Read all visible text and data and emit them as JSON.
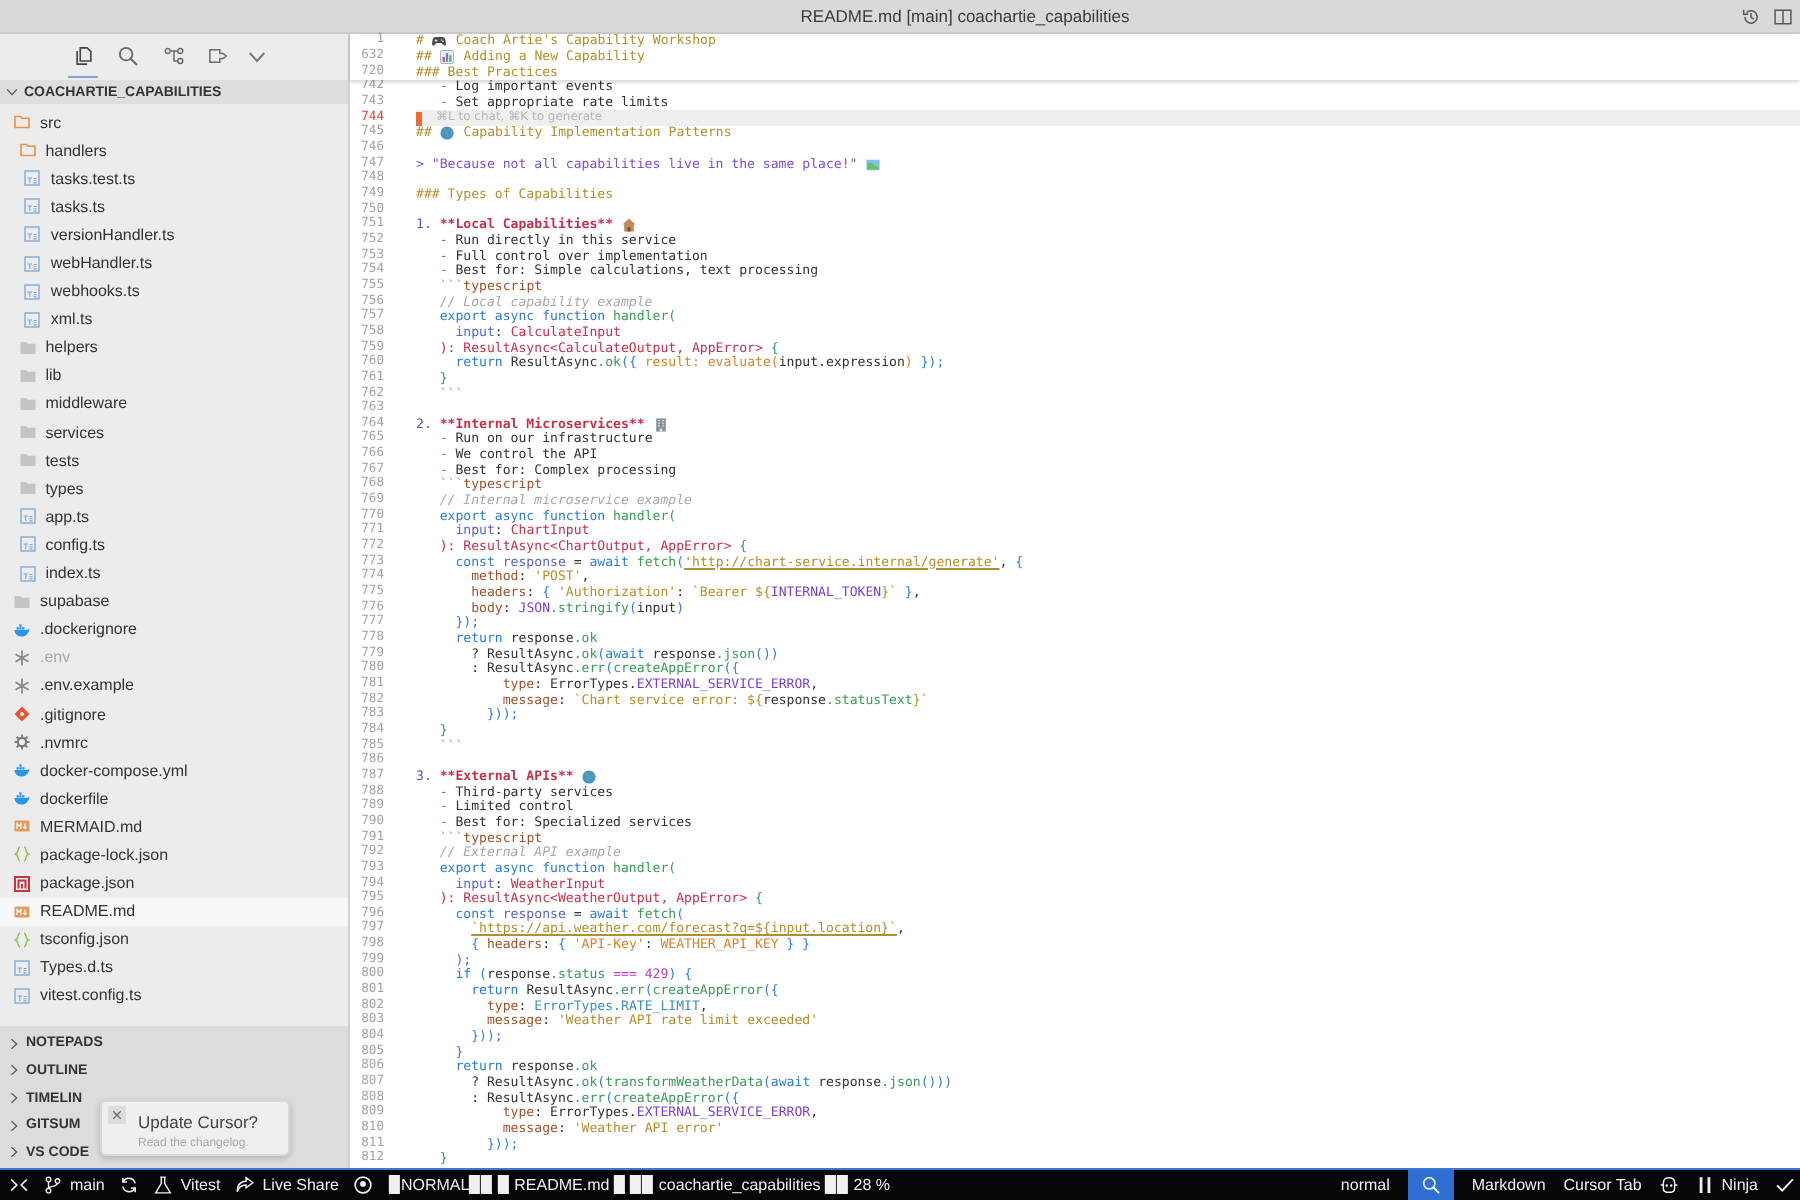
{
  "window": {
    "title": "README.md [main] coachartie_capabilities"
  },
  "activity_bar": [
    {
      "kind": "files",
      "selected": true
    },
    {
      "kind": "search",
      "selected": false
    },
    {
      "kind": "graph",
      "selected": false
    },
    {
      "kind": "extensions",
      "selected": false
    }
  ],
  "explorer": {
    "title": "COACHARTIE_CAPABILITIES",
    "expanded": true,
    "tree": [
      {
        "name": "src",
        "kind": "folder",
        "expanded": true,
        "selected": false,
        "ignored": false,
        "children": [
          {
            "name": "handlers",
            "kind": "folder",
            "expanded": true,
            "selected": false,
            "ignored": false,
            "children": [
              {
                "name": "tasks.test.ts",
                "kind": "ts",
                "selected": false,
                "ignored": false
              },
              {
                "name": "tasks.ts",
                "kind": "ts",
                "selected": false,
                "ignored": false
              },
              {
                "name": "versionHandler.ts",
                "kind": "ts",
                "selected": false,
                "ignored": false
              },
              {
                "name": "webHandler.ts",
                "kind": "ts",
                "selected": false,
                "ignored": false
              },
              {
                "name": "webhooks.ts",
                "kind": "ts",
                "selected": false,
                "ignored": false
              },
              {
                "name": "xml.ts",
                "kind": "ts",
                "selected": false,
                "ignored": false
              }
            ]
          },
          {
            "name": "helpers",
            "kind": "folder",
            "expanded": false,
            "selected": false,
            "ignored": false
          },
          {
            "name": "lib",
            "kind": "folder",
            "expanded": false,
            "selected": false,
            "ignored": false
          },
          {
            "name": "middleware",
            "kind": "folder",
            "expanded": false,
            "selected": false,
            "ignored": false
          },
          {
            "name": "services",
            "kind": "folder",
            "expanded": false,
            "selected": false,
            "ignored": false
          },
          {
            "name": "tests",
            "kind": "folder",
            "expanded": false,
            "selected": false,
            "ignored": false
          },
          {
            "name": "types",
            "kind": "folder",
            "expanded": false,
            "selected": false,
            "ignored": false
          },
          {
            "name": "app.ts",
            "kind": "ts",
            "selected": false,
            "ignored": false
          },
          {
            "name": "config.ts",
            "kind": "ts",
            "selected": false,
            "ignored": false
          },
          {
            "name": "index.ts",
            "kind": "ts",
            "selected": false,
            "ignored": false
          }
        ]
      },
      {
        "name": "supabase",
        "kind": "folder",
        "expanded": false,
        "selected": false,
        "ignored": false
      },
      {
        "name": ".dockerignore",
        "kind": "docker",
        "selected": false,
        "ignored": false
      },
      {
        "name": ".env",
        "kind": "env",
        "selected": false,
        "ignored": true
      },
      {
        "name": ".env.example",
        "kind": "env",
        "selected": false,
        "ignored": false
      },
      {
        "name": ".gitignore",
        "kind": "git",
        "selected": false,
        "ignored": false
      },
      {
        "name": ".nvmrc",
        "kind": "gear",
        "selected": false,
        "ignored": false
      },
      {
        "name": "docker-compose.yml",
        "kind": "docker",
        "selected": false,
        "ignored": false
      },
      {
        "name": "dockerfile",
        "kind": "docker",
        "selected": false,
        "ignored": false
      },
      {
        "name": "MERMAID.md",
        "kind": "markdown",
        "selected": false,
        "ignored": false
      },
      {
        "name": "package-lock.json",
        "kind": "json",
        "selected": false,
        "ignored": false
      },
      {
        "name": "package.json",
        "kind": "npm",
        "selected": false,
        "ignored": false
      },
      {
        "name": "README.md",
        "kind": "markdown",
        "selected": true,
        "ignored": false
      },
      {
        "name": "tsconfig.json",
        "kind": "json",
        "selected": false,
        "ignored": false
      },
      {
        "name": "Types.d.ts",
        "kind": "ts",
        "selected": false,
        "ignored": false
      },
      {
        "name": "vitest.config.ts",
        "kind": "ts",
        "selected": false,
        "ignored": false
      }
    ]
  },
  "panels": [
    {
      "label": "NOTEPADS",
      "expanded": false
    },
    {
      "label": "OUTLINE",
      "expanded": false
    },
    {
      "label": "TIMELIN",
      "expanded": false
    },
    {
      "label": "GITSUM",
      "expanded": false
    },
    {
      "label": "VS CODE",
      "expanded": false
    }
  ],
  "notification": {
    "title": "Update Cursor?",
    "message": "Read the changelog."
  },
  "editor": {
    "sticky_lines": [
      {
        "number": "1",
        "tokens": [
          {
            "kind": "heading",
            "text": "# "
          },
          {
            "kind": "gamepad"
          },
          {
            "kind": "heading",
            "text": " Coach Artie's Capability Workshop"
          }
        ]
      },
      {
        "number": "632",
        "tokens": [
          {
            "kind": "heading",
            "text": "## "
          },
          {
            "kind": "chart"
          },
          {
            "kind": "heading",
            "text": " Adding a New Capability"
          }
        ]
      },
      {
        "number": "720",
        "tokens": [
          {
            "kind": "heading",
            "text": "### Best Practices"
          }
        ]
      }
    ],
    "lines": [
      {
        "number": "742",
        "current": false,
        "tokens": [
          {
            "kind": "dash",
            "text": "   - "
          },
          {
            "kind": "plain",
            "text": "Log important events"
          }
        ]
      },
      {
        "number": "743",
        "current": false,
        "tokens": [
          {
            "kind": "dash",
            "text": "   - "
          },
          {
            "kind": "plain",
            "text": "Set appropriate rate limits"
          }
        ]
      },
      {
        "number": "744",
        "current": true,
        "hint": "⌘L to chat, ⌘K to generate"
      },
      {
        "number": "745",
        "current": false,
        "tokens": [
          {
            "kind": "heading",
            "text": "## "
          },
          {
            "kind": "globe"
          },
          {
            "kind": "heading",
            "text": " Capability Implementation Patterns"
          }
        ]
      },
      {
        "number": "746",
        "current": false
      },
      {
        "number": "747",
        "current": false,
        "tokens": [
          {
            "kind": "quote",
            "text": "> \"Because not all capabilities live in the same place!\" "
          },
          {
            "kind": "map"
          }
        ]
      },
      {
        "number": "748",
        "current": false
      },
      {
        "number": "749",
        "current": false,
        "tokens": [
          {
            "kind": "heading",
            "text": "### Types of Capabilities"
          }
        ]
      },
      {
        "number": "750",
        "current": false
      },
      {
        "number": "751",
        "current": false,
        "tokens": [
          {
            "kind": "listnum",
            "text": "1. "
          },
          {
            "kind": "bold",
            "text": "**Local Capabilities** "
          },
          {
            "kind": "house"
          }
        ]
      },
      {
        "number": "752",
        "current": false,
        "tokens": [
          {
            "kind": "dash",
            "text": "   - "
          },
          {
            "kind": "plain",
            "text": "Run directly in this service"
          }
        ]
      },
      {
        "number": "753",
        "current": false,
        "tokens": [
          {
            "kind": "dash",
            "text": "   - "
          },
          {
            "kind": "plain",
            "text": "Full control over implementation"
          }
        ]
      },
      {
        "number": "754",
        "current": false,
        "tokens": [
          {
            "kind": "dash",
            "text": "   - "
          },
          {
            "kind": "plain",
            "text": "Best for: Simple calculations, text processing"
          }
        ]
      },
      {
        "number": "755",
        "current": false,
        "tokens": [
          {
            "kind": "fence",
            "text": "   ```"
          },
          {
            "kind": "lang",
            "text": "typescript"
          }
        ]
      },
      {
        "number": "756",
        "current": false,
        "tokens": [
          {
            "kind": "comment",
            "text": "   // Local capability example"
          }
        ]
      },
      {
        "number": "757",
        "current": false,
        "tokens": [
          {
            "kind": "keyword",
            "text": "   export async function "
          },
          {
            "kind": "func",
            "text": "handler("
          }
        ]
      },
      {
        "number": "758",
        "current": false,
        "tokens": [
          {
            "kind": "param",
            "text": "     input"
          },
          {
            "kind": "plain",
            "text": ": "
          },
          {
            "kind": "type",
            "text": "CalculateInput"
          }
        ]
      },
      {
        "number": "759",
        "current": false,
        "tokens": [
          {
            "kind": "type",
            "text": "   ): ResultAsync<CalculateOutput, AppError> "
          },
          {
            "kind": "func",
            "text": "{"
          }
        ]
      },
      {
        "number": "760",
        "current": false,
        "tokens": [
          {
            "kind": "keyword",
            "text": "     return "
          },
          {
            "kind": "plain",
            "text": "ResultAsync"
          },
          {
            "kind": "func",
            "text": ".ok"
          },
          {
            "kind": "brace",
            "text": "({ "
          },
          {
            "kind": "prop",
            "text": "result: evaluate("
          },
          {
            "kind": "plain",
            "text": "input.expression"
          },
          {
            "kind": "prop",
            "text": ") "
          },
          {
            "kind": "brace",
            "text": "});"
          }
        ]
      },
      {
        "number": "761",
        "current": false,
        "tokens": [
          {
            "kind": "func",
            "text": "   }"
          }
        ]
      },
      {
        "number": "762",
        "current": false,
        "tokens": [
          {
            "kind": "fence",
            "text": "   ```"
          }
        ]
      },
      {
        "number": "763",
        "current": false
      },
      {
        "number": "764",
        "current": false,
        "tokens": [
          {
            "kind": "listnum",
            "text": "2. "
          },
          {
            "kind": "bold",
            "text": "**Internal Microservices** "
          },
          {
            "kind": "building"
          }
        ]
      },
      {
        "number": "765",
        "current": false,
        "tokens": [
          {
            "kind": "dash",
            "text": "   - "
          },
          {
            "kind": "plain",
            "text": "Run on our infrastructure"
          }
        ]
      },
      {
        "number": "766",
        "current": false,
        "tokens": [
          {
            "kind": "dash",
            "text": "   - "
          },
          {
            "kind": "plain",
            "text": "We control the API"
          }
        ]
      },
      {
        "number": "767",
        "current": false,
        "tokens": [
          {
            "kind": "dash",
            "text": "   - "
          },
          {
            "kind": "plain",
            "text": "Best for: Complex processing"
          }
        ]
      },
      {
        "number": "768",
        "current": false,
        "tokens": [
          {
            "kind": "fence",
            "text": "   ```"
          },
          {
            "kind": "lang",
            "text": "typescript"
          }
        ]
      },
      {
        "number": "769",
        "current": false,
        "tokens": [
          {
            "kind": "comment",
            "text": "   // Internal microservice example"
          }
        ]
      },
      {
        "number": "770",
        "current": false,
        "tokens": [
          {
            "kind": "keyword",
            "text": "   export async function "
          },
          {
            "kind": "func",
            "text": "handler("
          }
        ]
      },
      {
        "number": "771",
        "current": false,
        "tokens": [
          {
            "kind": "param",
            "text": "     input"
          },
          {
            "kind": "plain",
            "text": ": "
          },
          {
            "kind": "type",
            "text": "ChartInput"
          }
        ]
      },
      {
        "number": "772",
        "current": false,
        "tokens": [
          {
            "kind": "type",
            "text": "   ): ResultAsync<ChartOutput, AppError> "
          },
          {
            "kind": "func",
            "text": "{"
          }
        ]
      },
      {
        "number": "773",
        "current": false,
        "tokens": [
          {
            "kind": "keyword",
            "text": "     const "
          },
          {
            "kind": "param",
            "text": "response"
          },
          {
            "kind": "plain",
            "text": " = "
          },
          {
            "kind": "keyword",
            "text": "await "
          },
          {
            "kind": "func",
            "text": "fetch"
          },
          {
            "kind": "brace",
            "text": "("
          },
          {
            "kind": "link",
            "text": "'http://chart-service.internal/generate'"
          },
          {
            "kind": "plain",
            "text": ", "
          },
          {
            "kind": "brace",
            "text": "{"
          }
        ]
      },
      {
        "number": "774",
        "current": false,
        "tokens": [
          {
            "kind": "field",
            "text": "       method"
          },
          {
            "kind": "plain",
            "text": ": "
          },
          {
            "kind": "string",
            "text": "'POST'"
          },
          {
            "kind": "plain",
            "text": ","
          }
        ]
      },
      {
        "number": "775",
        "current": false,
        "tokens": [
          {
            "kind": "field",
            "text": "       headers"
          },
          {
            "kind": "plain",
            "text": ": "
          },
          {
            "kind": "brace",
            "text": "{ "
          },
          {
            "kind": "string",
            "text": "'Authorization'"
          },
          {
            "kind": "plain",
            "text": ": "
          },
          {
            "kind": "string",
            "text": "`Bearer ${"
          },
          {
            "kind": "constant",
            "text": "INTERNAL_TOKEN"
          },
          {
            "kind": "string",
            "text": "}`"
          },
          {
            "kind": "brace",
            "text": " }"
          },
          {
            "kind": "plain",
            "text": ","
          }
        ]
      },
      {
        "number": "776",
        "current": false,
        "tokens": [
          {
            "kind": "field",
            "text": "       body"
          },
          {
            "kind": "plain",
            "text": ": "
          },
          {
            "kind": "constant",
            "text": "JSON"
          },
          {
            "kind": "func",
            "text": ".stringify"
          },
          {
            "kind": "brace",
            "text": "("
          },
          {
            "kind": "plain",
            "text": "input"
          },
          {
            "kind": "brace",
            "text": ")"
          }
        ]
      },
      {
        "number": "777",
        "current": false,
        "tokens": [
          {
            "kind": "brace",
            "text": "     });"
          }
        ]
      },
      {
        "number": "778",
        "current": false,
        "tokens": [
          {
            "kind": "keyword",
            "text": "     return "
          },
          {
            "kind": "plain",
            "text": "response"
          },
          {
            "kind": "func",
            "text": ".ok"
          }
        ]
      },
      {
        "number": "779",
        "current": false,
        "tokens": [
          {
            "kind": "plain",
            "text": "       ? ResultAsync"
          },
          {
            "kind": "func",
            "text": ".ok"
          },
          {
            "kind": "brace",
            "text": "("
          },
          {
            "kind": "keyword",
            "text": "await "
          },
          {
            "kind": "plain",
            "text": "response"
          },
          {
            "kind": "func",
            "text": ".json"
          },
          {
            "kind": "brace",
            "text": "())"
          }
        ]
      },
      {
        "number": "780",
        "current": false,
        "tokens": [
          {
            "kind": "plain",
            "text": "       : ResultAsync"
          },
          {
            "kind": "func",
            "text": ".err"
          },
          {
            "kind": "brace",
            "text": "("
          },
          {
            "kind": "func",
            "text": "createAppError"
          },
          {
            "kind": "brace",
            "text": "({"
          }
        ]
      },
      {
        "number": "781",
        "current": false,
        "tokens": [
          {
            "kind": "field",
            "text": "           type"
          },
          {
            "kind": "plain",
            "text": ": ErrorTypes."
          },
          {
            "kind": "constant",
            "text": "EXTERNAL_SERVICE_ERROR"
          },
          {
            "kind": "plain",
            "text": ","
          }
        ]
      },
      {
        "number": "782",
        "current": false,
        "tokens": [
          {
            "kind": "field",
            "text": "           message"
          },
          {
            "kind": "plain",
            "text": ": "
          },
          {
            "kind": "string",
            "text": "`Chart service error: ${"
          },
          {
            "kind": "plain",
            "text": "response"
          },
          {
            "kind": "func",
            "text": ".statusText"
          },
          {
            "kind": "string",
            "text": "}`"
          }
        ]
      },
      {
        "number": "783",
        "current": false,
        "tokens": [
          {
            "kind": "brace",
            "text": "         }));"
          }
        ]
      },
      {
        "number": "784",
        "current": false,
        "tokens": [
          {
            "kind": "func",
            "text": "   }"
          }
        ]
      },
      {
        "number": "785",
        "current": false,
        "tokens": [
          {
            "kind": "fence",
            "text": "   ```"
          }
        ]
      },
      {
        "number": "786",
        "current": false
      },
      {
        "number": "787",
        "current": false,
        "tokens": [
          {
            "kind": "listnum",
            "text": "3. "
          },
          {
            "kind": "bold",
            "text": "**External APIs** "
          },
          {
            "kind": "globe"
          }
        ]
      },
      {
        "number": "788",
        "current": false,
        "tokens": [
          {
            "kind": "dash",
            "text": "   - "
          },
          {
            "kind": "plain",
            "text": "Third-party services"
          }
        ]
      },
      {
        "number": "789",
        "current": false,
        "tokens": [
          {
            "kind": "dash",
            "text": "   - "
          },
          {
            "kind": "plain",
            "text": "Limited control"
          }
        ]
      },
      {
        "number": "790",
        "current": false,
        "tokens": [
          {
            "kind": "dash",
            "text": "   - "
          },
          {
            "kind": "plain",
            "text": "Best for: Specialized services"
          }
        ]
      },
      {
        "number": "791",
        "current": false,
        "tokens": [
          {
            "kind": "fence",
            "text": "   ```"
          },
          {
            "kind": "lang",
            "text": "typescript"
          }
        ]
      },
      {
        "number": "792",
        "current": false,
        "tokens": [
          {
            "kind": "comment",
            "text": "   // External API example"
          }
        ]
      },
      {
        "number": "793",
        "current": false,
        "tokens": [
          {
            "kind": "keyword",
            "text": "   export async function "
          },
          {
            "kind": "func",
            "text": "handler("
          }
        ]
      },
      {
        "number": "794",
        "current": false,
        "tokens": [
          {
            "kind": "param",
            "text": "     input"
          },
          {
            "kind": "plain",
            "text": ": "
          },
          {
            "kind": "type",
            "text": "WeatherInput"
          }
        ]
      },
      {
        "number": "795",
        "current": false,
        "tokens": [
          {
            "kind": "type",
            "text": "   ): ResultAsync<WeatherOutput, AppError> "
          },
          {
            "kind": "func",
            "text": "{"
          }
        ]
      },
      {
        "number": "796",
        "current": false,
        "tokens": [
          {
            "kind": "keyword",
            "text": "     const "
          },
          {
            "kind": "param",
            "text": "response"
          },
          {
            "kind": "plain",
            "text": " = "
          },
          {
            "kind": "keyword",
            "text": "await "
          },
          {
            "kind": "func",
            "text": "fetch"
          },
          {
            "kind": "brace",
            "text": "("
          }
        ]
      },
      {
        "number": "797",
        "current": false,
        "tokens": [
          {
            "kind": "link",
            "text": "       `https://api.weather.com/forecast?q=${input.location}`"
          },
          {
            "kind": "plain",
            "text": ","
          }
        ]
      },
      {
        "number": "798",
        "current": false,
        "tokens": [
          {
            "kind": "brace",
            "text": "       { "
          },
          {
            "kind": "field",
            "text": "headers"
          },
          {
            "kind": "plain",
            "text": ": "
          },
          {
            "kind": "brace",
            "text": "{ "
          },
          {
            "kind": "prop",
            "text": "'API-Key'"
          },
          {
            "kind": "plain",
            "text": ": "
          },
          {
            "kind": "prop",
            "text": "WEATHER_API_KEY"
          },
          {
            "kind": "brace",
            "text": " } }"
          }
        ]
      },
      {
        "number": "799",
        "current": false,
        "tokens": [
          {
            "kind": "brace",
            "text": "     );"
          }
        ]
      },
      {
        "number": "800",
        "current": false,
        "tokens": [
          {
            "kind": "keyword",
            "text": "     if "
          },
          {
            "kind": "brace",
            "text": "("
          },
          {
            "kind": "plain",
            "text": "response"
          },
          {
            "kind": "func",
            "text": ".status"
          },
          {
            "kind": "number",
            "text": " === 429"
          },
          {
            "kind": "brace",
            "text": ") {"
          }
        ]
      },
      {
        "number": "801",
        "current": false,
        "tokens": [
          {
            "kind": "keyword",
            "text": "       return "
          },
          {
            "kind": "plain",
            "text": "ResultAsync"
          },
          {
            "kind": "func",
            "text": ".err"
          },
          {
            "kind": "brace",
            "text": "("
          },
          {
            "kind": "func",
            "text": "createAppError"
          },
          {
            "kind": "brace",
            "text": "({"
          }
        ]
      },
      {
        "number": "802",
        "current": false,
        "tokens": [
          {
            "kind": "field",
            "text": "         type"
          },
          {
            "kind": "plain",
            "text": ": "
          },
          {
            "kind": "enumval",
            "text": "ErrorTypes.RATE_LIMIT"
          },
          {
            "kind": "plain",
            "text": ","
          }
        ]
      },
      {
        "number": "803",
        "current": false,
        "tokens": [
          {
            "kind": "field",
            "text": "         message"
          },
          {
            "kind": "plain",
            "text": ": "
          },
          {
            "kind": "string",
            "text": "'Weather API rate limit exceeded'"
          }
        ]
      },
      {
        "number": "804",
        "current": false,
        "tokens": [
          {
            "kind": "brace",
            "text": "       }));"
          }
        ]
      },
      {
        "number": "805",
        "current": false,
        "tokens": [
          {
            "kind": "brace",
            "text": "     }"
          }
        ]
      },
      {
        "number": "806",
        "current": false,
        "tokens": [
          {
            "kind": "keyword",
            "text": "     return "
          },
          {
            "kind": "plain",
            "text": "response"
          },
          {
            "kind": "func",
            "text": ".ok"
          }
        ]
      },
      {
        "number": "807",
        "current": false,
        "tokens": [
          {
            "kind": "plain",
            "text": "       ? ResultAsync"
          },
          {
            "kind": "func",
            "text": ".ok"
          },
          {
            "kind": "brace",
            "text": "("
          },
          {
            "kind": "func",
            "text": "transformWeatherData"
          },
          {
            "kind": "brace",
            "text": "("
          },
          {
            "kind": "keyword",
            "text": "await "
          },
          {
            "kind": "plain",
            "text": "response"
          },
          {
            "kind": "func",
            "text": ".json"
          },
          {
            "kind": "brace",
            "text": "()))"
          }
        ]
      },
      {
        "number": "808",
        "current": false,
        "tokens": [
          {
            "kind": "plain",
            "text": "       : ResultAsync"
          },
          {
            "kind": "func",
            "text": ".err"
          },
          {
            "kind": "brace",
            "text": "("
          },
          {
            "kind": "func",
            "text": "createAppError"
          },
          {
            "kind": "brace",
            "text": "({"
          }
        ]
      },
      {
        "number": "809",
        "current": false,
        "tokens": [
          {
            "kind": "field",
            "text": "           type"
          },
          {
            "kind": "plain",
            "text": ": ErrorTypes."
          },
          {
            "kind": "constant",
            "text": "EXTERNAL_SERVICE_ERROR"
          },
          {
            "kind": "plain",
            "text": ","
          }
        ]
      },
      {
        "number": "810",
        "current": false,
        "tokens": [
          {
            "kind": "field",
            "text": "           message"
          },
          {
            "kind": "plain",
            "text": ": "
          },
          {
            "kind": "string",
            "text": "'Weather API error'"
          }
        ]
      },
      {
        "number": "811",
        "current": false,
        "tokens": [
          {
            "kind": "brace",
            "text": "         }));"
          }
        ]
      },
      {
        "number": "812",
        "current": false,
        "tokens": [
          {
            "kind": "func",
            "text": "   }"
          }
        ]
      }
    ]
  },
  "status_bar": {
    "left": [
      {
        "kind": "remote"
      },
      {
        "kind": "branch",
        "label": "main"
      },
      {
        "kind": "sync"
      },
      {
        "kind": "test",
        "label": "Vitest"
      },
      {
        "kind": "share",
        "label": "Live Share"
      },
      {
        "kind": "account"
      },
      {
        "kind": "text",
        "label": "▉NORMAL▉▉ ▉ README.md ▉ ▉▉ coachartie_capabilities ▉▉ 28 %"
      }
    ],
    "right": [
      {
        "kind": "text",
        "label": "normal"
      },
      {
        "kind": "search"
      },
      {
        "kind": "text",
        "label": "Markdown"
      },
      {
        "kind": "text",
        "label": "Cursor Tab"
      },
      {
        "kind": "assistant"
      },
      {
        "kind": "bars",
        "label": "Ninja"
      },
      {
        "kind": "check"
      }
    ]
  }
}
